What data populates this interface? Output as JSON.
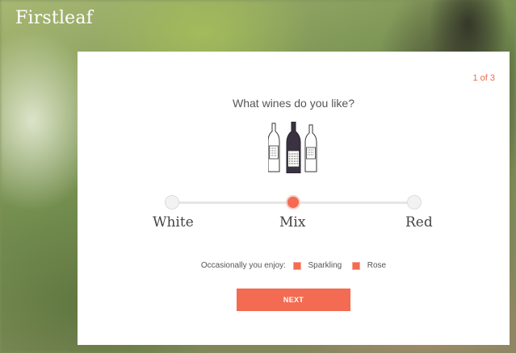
{
  "brand": {
    "logo_text": "Firstleaf"
  },
  "quiz": {
    "step": "1 of 3",
    "question": "What wines do you like?",
    "illustration_icon": "wine-bottles-icon",
    "options": [
      {
        "label": "White",
        "selected": false
      },
      {
        "label": "Mix",
        "selected": true
      },
      {
        "label": "Red",
        "selected": false
      }
    ],
    "occasional": {
      "prompt": "Occasionally you enjoy:",
      "items": [
        {
          "label": "Sparkling",
          "checked": true
        },
        {
          "label": "Rose",
          "checked": true
        }
      ]
    },
    "next_label": "NEXT"
  },
  "colors": {
    "accent": "#f36b52",
    "text": "#555555"
  }
}
